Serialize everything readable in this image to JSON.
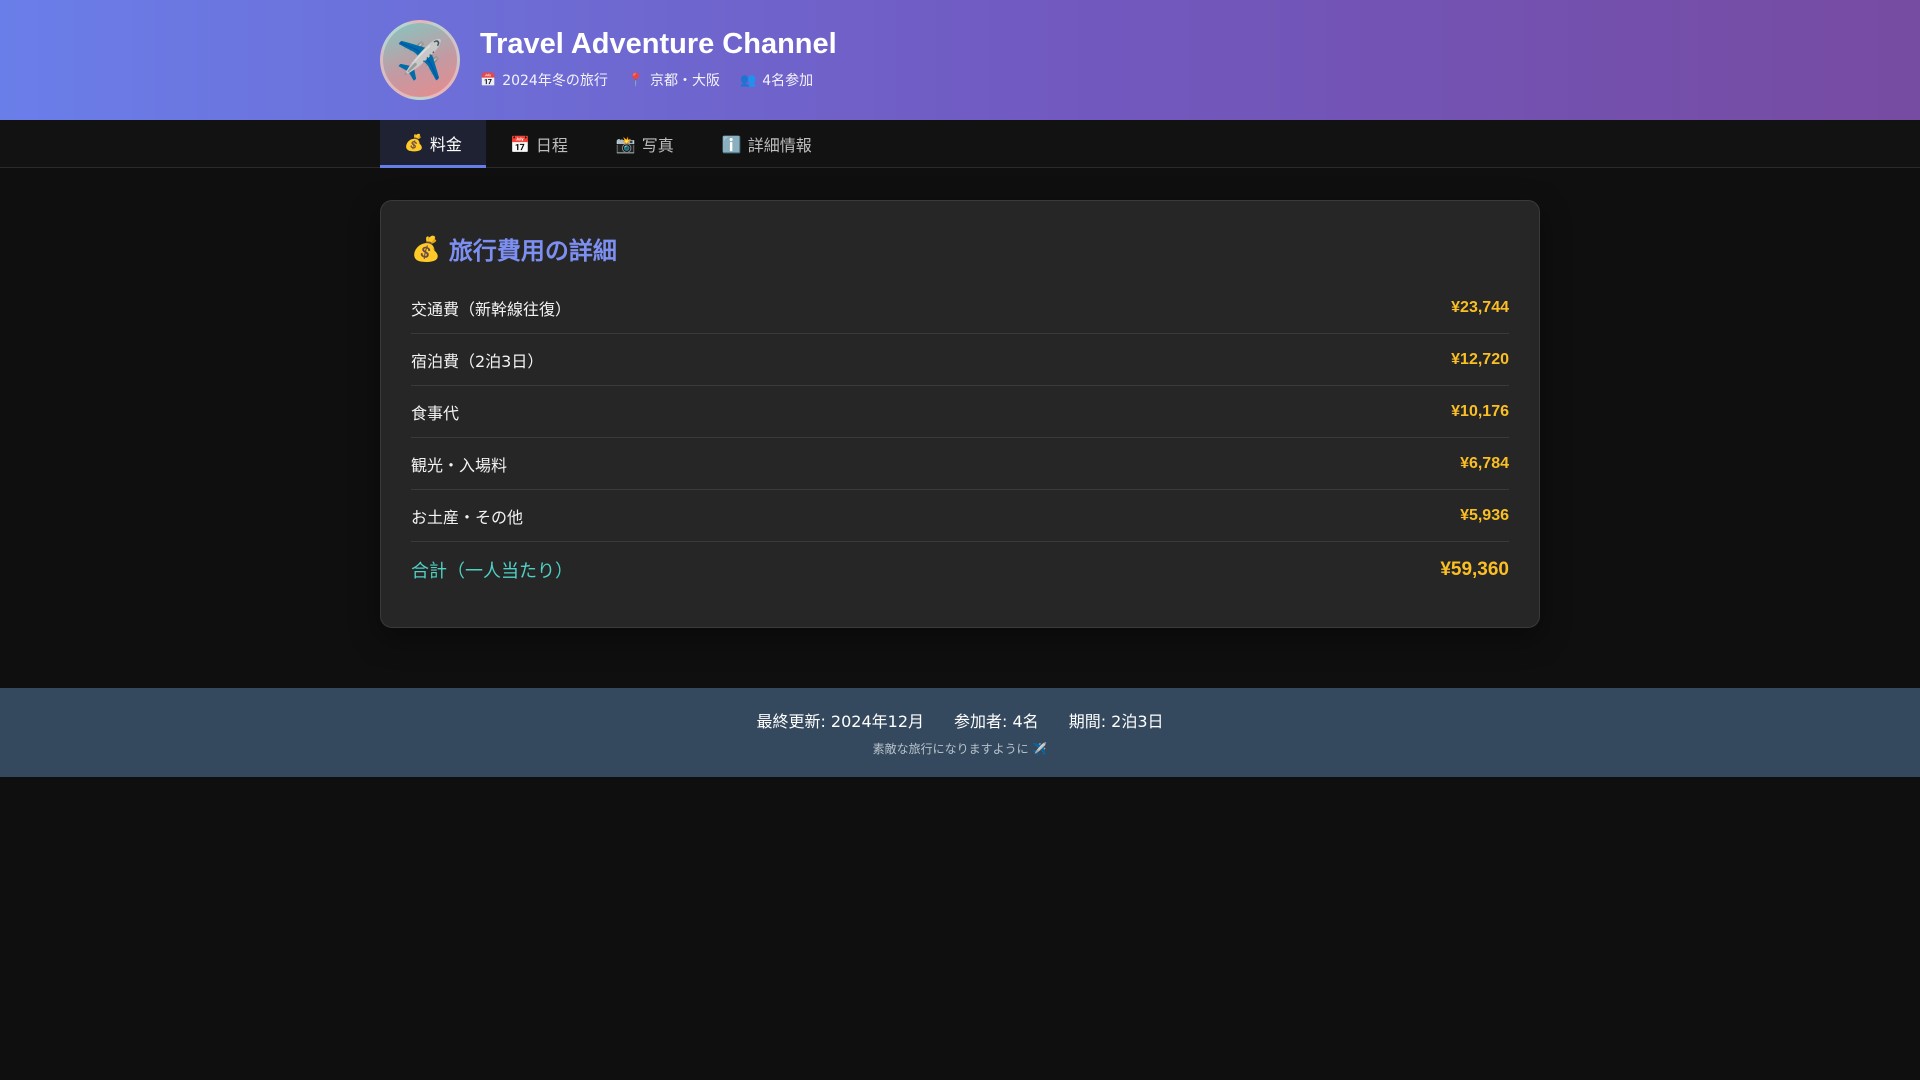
{
  "header": {
    "avatar_icon": "✈️",
    "avatar_icon_name": "airplane-icon",
    "title": "Travel Adventure Channel",
    "meta": [
      {
        "icon": "📅",
        "icon_name": "calendar-icon",
        "text": "2024年冬の旅行"
      },
      {
        "icon": "📍",
        "icon_name": "pin-icon",
        "text": "京都・大阪"
      },
      {
        "icon": "👥",
        "icon_name": "people-icon",
        "text": "4名参加"
      }
    ]
  },
  "tabs": [
    {
      "icon": "💰",
      "icon_name": "money-bag-icon",
      "label": "料金",
      "active": true
    },
    {
      "icon": "📅",
      "icon_name": "calendar-icon",
      "label": "日程",
      "active": false
    },
    {
      "icon": "📸",
      "icon_name": "camera-icon",
      "label": "写真",
      "active": false
    },
    {
      "icon": "ℹ️",
      "icon_name": "info-icon",
      "label": "詳細情報",
      "active": false
    }
  ],
  "cost": {
    "title_icon": "💰",
    "title": "旅行費用の詳細",
    "items": [
      {
        "label": "交通費（新幹線往復）",
        "value": "¥23,744"
      },
      {
        "label": "宿泊費（2泊3日）",
        "value": "¥12,720"
      },
      {
        "label": "食事代",
        "value": "¥10,176"
      },
      {
        "label": "観光・入場料",
        "value": "¥6,784"
      },
      {
        "label": "お土産・その他",
        "value": "¥5,936"
      }
    ],
    "total_label": "合計（一人当たり）",
    "total_value": "¥59,360"
  },
  "footer": {
    "last_updated": "最終更新: 2024年12月",
    "participants": "参加者: 4名",
    "duration": "期間: 2泊3日",
    "message": "素敵な旅行になりますように ✈️"
  },
  "colors": {
    "header_gradient_start": "#6a7ee9",
    "header_gradient_end": "#764ba2",
    "accent": "#667eea",
    "price": "#fbbf24",
    "total_label": "#4fd1c5",
    "footer_bg": "#34495e"
  }
}
